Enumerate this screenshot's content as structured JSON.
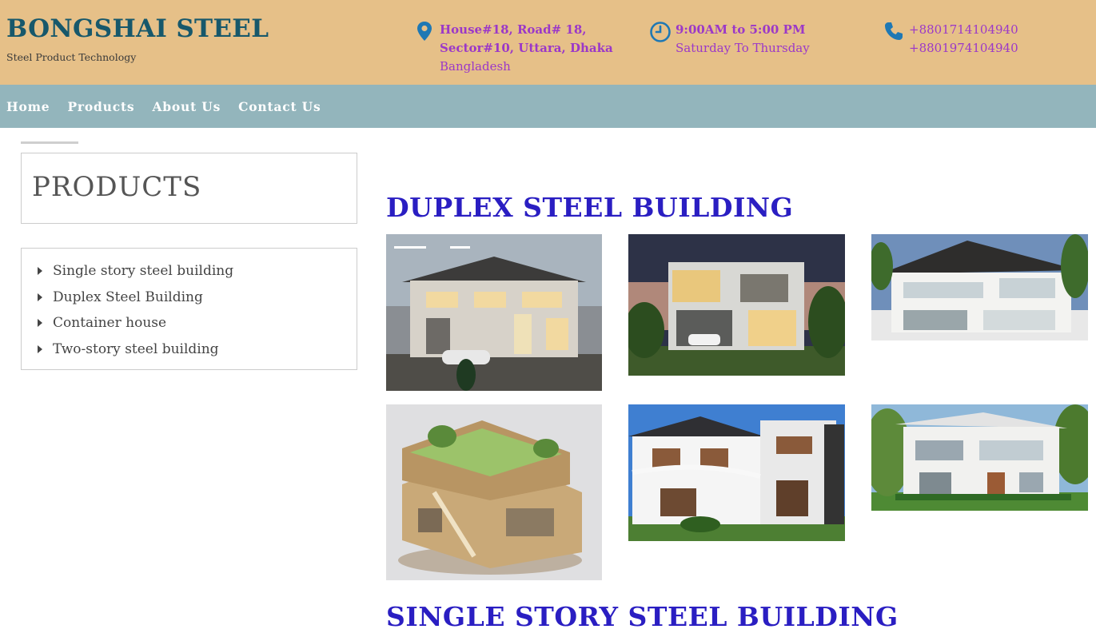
{
  "header": {
    "brand_title": "BONGSHAI STEEL",
    "brand_subtitle": "Steel Product Technology",
    "address": {
      "icon": "map-pin-icon",
      "line1": "House#18, Road# 18,",
      "line2": "Sector#10, Uttara, Dhaka",
      "line3": "Bangladesh"
    },
    "hours": {
      "icon": "clock-icon",
      "line1": "9:00AM to 5:00 PM",
      "line2": "Saturday To Thursday"
    },
    "phone": {
      "icon": "phone-icon",
      "line1": "+8801714104940",
      "line2": "+8801974104940"
    },
    "info_color": "#9b38c8",
    "brand_color": "#17586b",
    "background": "#e6c088"
  },
  "nav": {
    "items": [
      "Home",
      "Products",
      "About Us",
      "Contact Us"
    ],
    "background": "#93b5bc"
  },
  "sidebar": {
    "heading": "PRODUCTS",
    "items": [
      "Single story steel building",
      "Duplex Steel Building",
      "Container house",
      "Two-story steel building"
    ]
  },
  "main": {
    "section1_title": "DUPLEX STEEL BUILDING",
    "section2_title": "SINGLE STORY STEEL BUILDING",
    "title_color": "#2a1ec2"
  }
}
